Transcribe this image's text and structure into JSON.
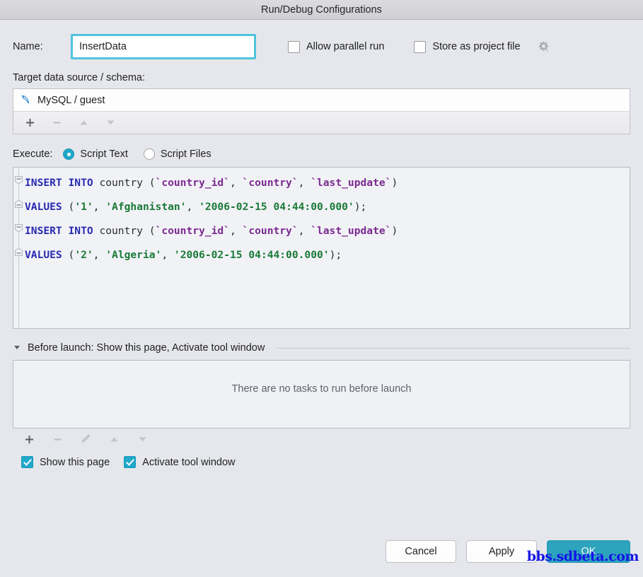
{
  "window": {
    "title": "Run/Debug Configurations"
  },
  "name_row": {
    "label": "Name:",
    "value": "InsertData",
    "placeholder": "",
    "allow_parallel_run": {
      "label": "Allow parallel run",
      "checked": false
    },
    "store_as_project_file": {
      "label": "Store as project file",
      "checked": false
    },
    "gear_icon": "gear-icon"
  },
  "target": {
    "label": "Target data source / schema:",
    "rows": [
      {
        "icon": "mysql-dolphin-icon",
        "text": "MySQL / guest"
      }
    ],
    "toolbar": [
      {
        "name": "add-button",
        "glyph": "+",
        "enabled": true
      },
      {
        "name": "remove-button",
        "glyph": "−",
        "enabled": false
      },
      {
        "name": "move-up-button",
        "glyph": "▲",
        "enabled": false
      },
      {
        "name": "move-down-button",
        "glyph": "▼",
        "enabled": false
      }
    ]
  },
  "execute": {
    "label": "Execute:",
    "options": [
      {
        "label": "Script Text",
        "selected": true
      },
      {
        "label": "Script Files",
        "selected": false
      }
    ]
  },
  "editor": {
    "lines": [
      {
        "fold": "start",
        "tokens": [
          {
            "t": "INSERT INTO ",
            "c": "k"
          },
          {
            "t": "country ",
            "c": "id"
          },
          {
            "t": "(",
            "c": "pn"
          },
          {
            "t": "`country_id`",
            "c": "bt"
          },
          {
            "t": ", ",
            "c": "pn"
          },
          {
            "t": "`country`",
            "c": "bt"
          },
          {
            "t": ", ",
            "c": "pn"
          },
          {
            "t": "`last_update`",
            "c": "bt"
          },
          {
            "t": ")",
            "c": "pn"
          }
        ]
      },
      {
        "fold": "end",
        "tokens": [
          {
            "t": "VALUES ",
            "c": "k"
          },
          {
            "t": "(",
            "c": "pn"
          },
          {
            "t": "'1'",
            "c": "st"
          },
          {
            "t": ", ",
            "c": "pn"
          },
          {
            "t": "'Afghanistan'",
            "c": "st"
          },
          {
            "t": ", ",
            "c": "pn"
          },
          {
            "t": "'2006-02-15 04:44:00.000'",
            "c": "st"
          },
          {
            "t": ");",
            "c": "pn"
          }
        ]
      },
      {
        "fold": "start",
        "tokens": [
          {
            "t": "INSERT INTO ",
            "c": "k"
          },
          {
            "t": "country ",
            "c": "id"
          },
          {
            "t": "(",
            "c": "pn"
          },
          {
            "t": "`country_id`",
            "c": "bt"
          },
          {
            "t": ", ",
            "c": "pn"
          },
          {
            "t": "`country`",
            "c": "bt"
          },
          {
            "t": ", ",
            "c": "pn"
          },
          {
            "t": "`last_update`",
            "c": "bt"
          },
          {
            "t": ")",
            "c": "pn"
          }
        ]
      },
      {
        "fold": "end",
        "tokens": [
          {
            "t": "VALUES ",
            "c": "k"
          },
          {
            "t": "(",
            "c": "pn"
          },
          {
            "t": "'2'",
            "c": "st"
          },
          {
            "t": ", ",
            "c": "pn"
          },
          {
            "t": "'Algeria'",
            "c": "st"
          },
          {
            "t": ", ",
            "c": "pn"
          },
          {
            "t": "'2006-02-15 04:44:00.000'",
            "c": "st"
          },
          {
            "t": ");",
            "c": "pn"
          }
        ]
      }
    ]
  },
  "before_launch": {
    "title": "Before launch: Show this page, Activate tool window",
    "empty_text": "There are no tasks to run before launch",
    "toolbar": [
      {
        "name": "add-task-button",
        "glyph": "+",
        "enabled": true
      },
      {
        "name": "remove-task-button",
        "glyph": "−",
        "enabled": false
      },
      {
        "name": "edit-task-button",
        "glyph": "pencil-icon",
        "enabled": false
      },
      {
        "name": "move-task-up-button",
        "glyph": "▲",
        "enabled": false
      },
      {
        "name": "move-task-down-button",
        "glyph": "▼",
        "enabled": false
      }
    ],
    "checkboxes": [
      {
        "label": "Show this page",
        "checked": true
      },
      {
        "label": "Activate tool window",
        "checked": true
      }
    ]
  },
  "buttons": {
    "cancel": "Cancel",
    "apply": "Apply",
    "ok": "OK"
  },
  "watermark": "bbs.sdbeta.com",
  "colors": {
    "accent": "#1fa8c9",
    "primary_button": "#2da3bd",
    "focus_ring": "#4fc3dd",
    "keyword": "#2a2ab0",
    "string": "#1a7a38",
    "backtick_identifier": "#7b2a8f",
    "watermark": "#1414e8"
  }
}
